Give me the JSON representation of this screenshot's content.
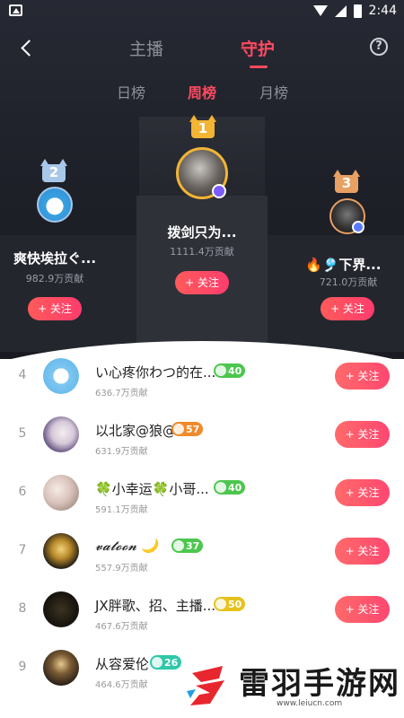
{
  "status_bar": {
    "time": "2:44"
  },
  "header": {
    "tabs": [
      {
        "label": "主播"
      },
      {
        "label": "守护"
      }
    ],
    "active_tab": "守护",
    "sub_tabs": [
      {
        "label": "日榜"
      },
      {
        "label": "周榜"
      },
      {
        "label": "月榜"
      }
    ],
    "active_sub_tab": "周榜",
    "help_label": "?"
  },
  "podium": {
    "first": {
      "rank": "1",
      "name": "拨剑只为...",
      "contribution": "1111.4万贡献",
      "follow_label": "+ 关注"
    },
    "second": {
      "rank": "2",
      "name": "爽快埃拉ぐ...",
      "contribution": "982.9万贡献",
      "follow_label": "+ 关注"
    },
    "third": {
      "rank": "3",
      "name": "🔥🎐下界...",
      "contribution": "721.0万贡献",
      "follow_label": "+ 关注"
    }
  },
  "list": [
    {
      "rank": "4",
      "name": "い心疼你わつ的在...",
      "level": "40",
      "level_color": "#4cc64f",
      "contribution": "636.7万贡献",
      "follow_label": "+ 关注"
    },
    {
      "rank": "5",
      "name": "以北家@狼@",
      "level": "57",
      "level_color": "#f08a2a",
      "contribution": "631.9万贡献",
      "follow_label": "+ 关注"
    },
    {
      "rank": "6",
      "name": "🍀小幸运🍀小哥...",
      "level": "40",
      "level_color": "#4cc64f",
      "contribution": "591.1万贡献",
      "follow_label": "+ 关注"
    },
    {
      "rank": "7",
      "name": "𝓿𝓪𝓽𝓸𝓸𝓷 🌙",
      "level": "37",
      "level_color": "#4cc64f",
      "contribution": "557.9万贡献",
      "follow_label": "+ 关注"
    },
    {
      "rank": "8",
      "name": "JX胖歌、招、主播...",
      "level": "50",
      "level_color": "#e5c21c",
      "contribution": "467.6万贡献",
      "follow_label": "+ 关注"
    },
    {
      "rank": "9",
      "name": "从容爱伦",
      "level": "26",
      "level_color": "#2fc7a8",
      "contribution": "464.6万贡献",
      "follow_label": "+ 关注"
    }
  ],
  "watermark": {
    "title": "雷羽手游网",
    "url": "www.leiucn.com"
  },
  "colors": {
    "accent": "#ff4a5f",
    "dark_bg": "#1d1f27",
    "gold": "#f2b534",
    "silver": "#a9c7e8",
    "bronze": "#e8a063"
  }
}
